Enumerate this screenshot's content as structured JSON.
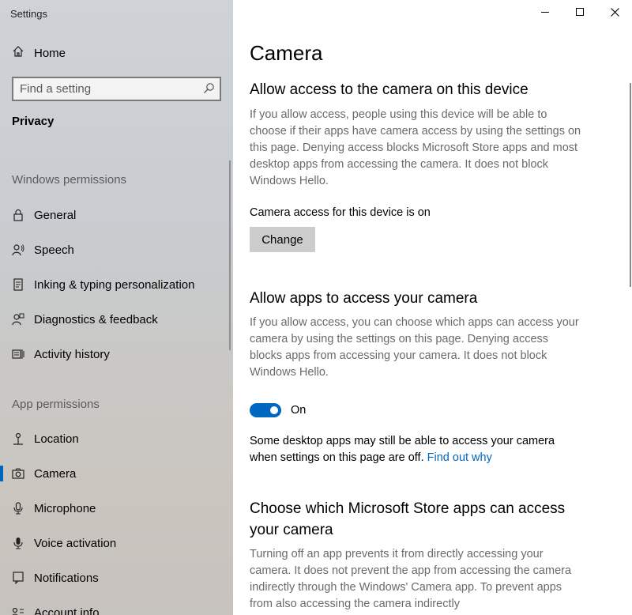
{
  "window": {
    "title": "Settings"
  },
  "sidebar": {
    "home_label": "Home",
    "search_placeholder": "Find a setting",
    "category": "Privacy",
    "windows_permissions_header": "Windows permissions",
    "windows_permissions": [
      {
        "label": "General",
        "icon": "lock-icon"
      },
      {
        "label": "Speech",
        "icon": "speech-icon"
      },
      {
        "label": "Inking & typing personalization",
        "icon": "inking-icon"
      },
      {
        "label": "Diagnostics & feedback",
        "icon": "diagnostics-icon"
      },
      {
        "label": "Activity history",
        "icon": "activity-icon"
      }
    ],
    "app_permissions_header": "App permissions",
    "app_permissions": [
      {
        "label": "Location",
        "icon": "location-icon"
      },
      {
        "label": "Camera",
        "icon": "camera-icon",
        "selected": true
      },
      {
        "label": "Microphone",
        "icon": "microphone-icon"
      },
      {
        "label": "Voice activation",
        "icon": "voice-activation-icon"
      },
      {
        "label": "Notifications",
        "icon": "notifications-icon"
      },
      {
        "label": "Account info",
        "icon": "account-info-icon"
      }
    ]
  },
  "main": {
    "page_title": "Camera",
    "device_section": {
      "heading": "Allow access to the camera on this device",
      "description": "If you allow access, people using this device will be able to choose if their apps have camera access by using the settings on this page. Denying access blocks Microsoft Store apps and most desktop apps from accessing the camera. It does not block Windows Hello.",
      "status": "Camera access for this device is on",
      "change_label": "Change"
    },
    "apps_section": {
      "heading": "Allow apps to access your camera",
      "description": "If you allow access, you can choose which apps can access your camera by using the settings on this page. Denying access blocks apps from accessing your camera. It does not block Windows Hello.",
      "toggle_state": "On",
      "note": "Some desktop apps may still be able to access your camera when settings on this page are off.",
      "link": "Find out why"
    },
    "store_section": {
      "heading": "Choose which Microsoft Store apps can access your camera",
      "description": "Turning off an app prevents it from directly accessing your camera. It does not prevent the app from accessing the camera indirectly through the Windows' Camera app. To prevent apps from also accessing the camera indirectly"
    }
  },
  "colors": {
    "accent": "#0067c0",
    "button_bg": "#cccccc",
    "description_text": "#6a6a6a"
  }
}
